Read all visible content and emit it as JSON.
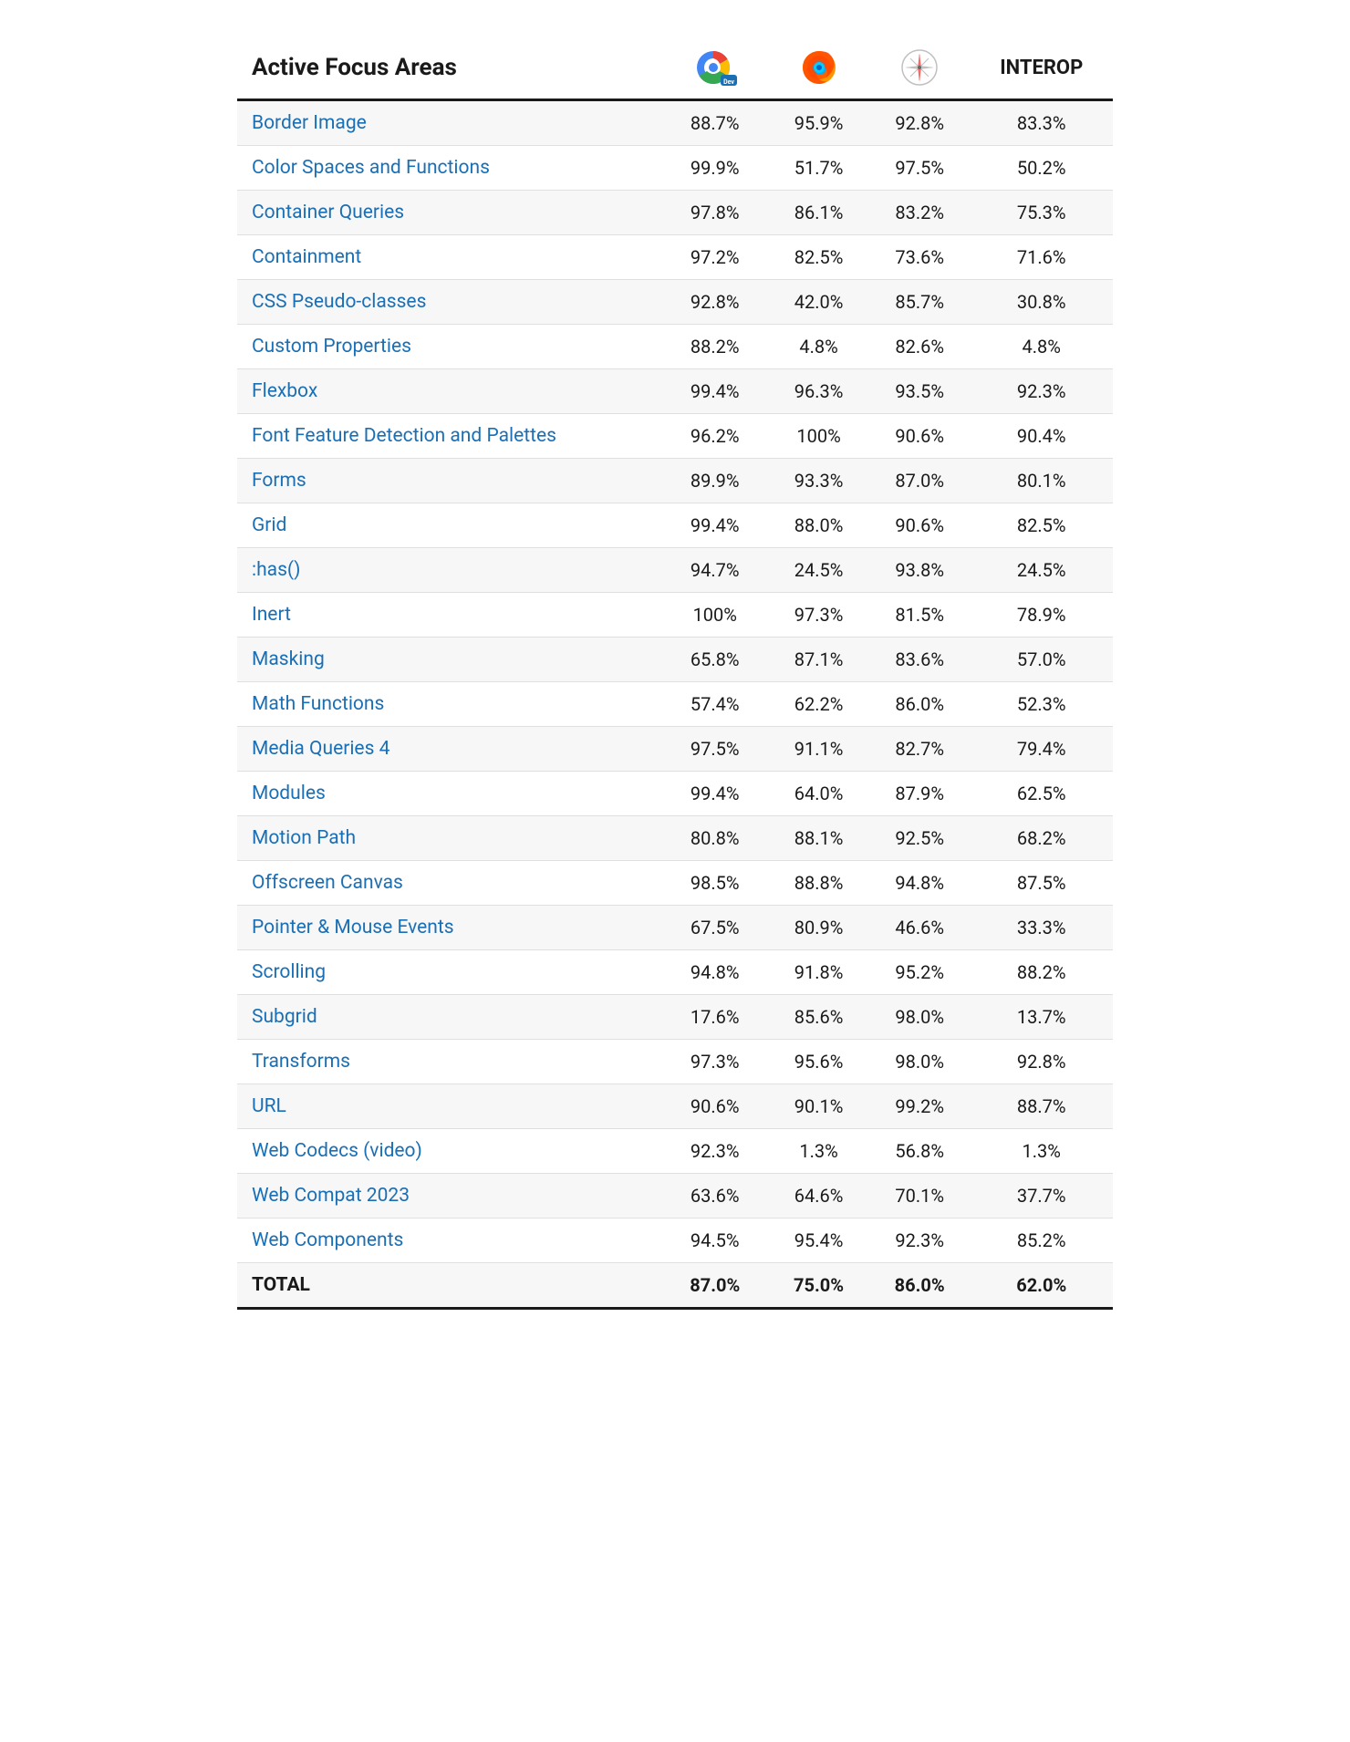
{
  "header": {
    "col1": "Active Focus Areas",
    "col4": "INTEROP"
  },
  "rows": [
    {
      "name": "Border Image",
      "col2": "88.7%",
      "col3": "95.9%",
      "col4": "92.8%",
      "col5": "83.3%"
    },
    {
      "name": "Color Spaces and Functions",
      "col2": "99.9%",
      "col3": "51.7%",
      "col4": "97.5%",
      "col5": "50.2%"
    },
    {
      "name": "Container Queries",
      "col2": "97.8%",
      "col3": "86.1%",
      "col4": "83.2%",
      "col5": "75.3%"
    },
    {
      "name": "Containment",
      "col2": "97.2%",
      "col3": "82.5%",
      "col4": "73.6%",
      "col5": "71.6%"
    },
    {
      "name": "CSS Pseudo-classes",
      "col2": "92.8%",
      "col3": "42.0%",
      "col4": "85.7%",
      "col5": "30.8%"
    },
    {
      "name": "Custom Properties",
      "col2": "88.2%",
      "col3": "4.8%",
      "col4": "82.6%",
      "col5": "4.8%"
    },
    {
      "name": "Flexbox",
      "col2": "99.4%",
      "col3": "96.3%",
      "col4": "93.5%",
      "col5": "92.3%"
    },
    {
      "name": "Font Feature Detection and Palettes",
      "col2": "96.2%",
      "col3": "100%",
      "col4": "90.6%",
      "col5": "90.4%"
    },
    {
      "name": "Forms",
      "col2": "89.9%",
      "col3": "93.3%",
      "col4": "87.0%",
      "col5": "80.1%"
    },
    {
      "name": "Grid",
      "col2": "99.4%",
      "col3": "88.0%",
      "col4": "90.6%",
      "col5": "82.5%"
    },
    {
      "name": ":has()",
      "col2": "94.7%",
      "col3": "24.5%",
      "col4": "93.8%",
      "col5": "24.5%"
    },
    {
      "name": "Inert",
      "col2": "100%",
      "col3": "97.3%",
      "col4": "81.5%",
      "col5": "78.9%"
    },
    {
      "name": "Masking",
      "col2": "65.8%",
      "col3": "87.1%",
      "col4": "83.6%",
      "col5": "57.0%"
    },
    {
      "name": "Math Functions",
      "col2": "57.4%",
      "col3": "62.2%",
      "col4": "86.0%",
      "col5": "52.3%"
    },
    {
      "name": "Media Queries 4",
      "col2": "97.5%",
      "col3": "91.1%",
      "col4": "82.7%",
      "col5": "79.4%"
    },
    {
      "name": "Modules",
      "col2": "99.4%",
      "col3": "64.0%",
      "col4": "87.9%",
      "col5": "62.5%"
    },
    {
      "name": "Motion Path",
      "col2": "80.8%",
      "col3": "88.1%",
      "col4": "92.5%",
      "col5": "68.2%"
    },
    {
      "name": "Offscreen Canvas",
      "col2": "98.5%",
      "col3": "88.8%",
      "col4": "94.8%",
      "col5": "87.5%"
    },
    {
      "name": "Pointer & Mouse Events",
      "col2": "67.5%",
      "col3": "80.9%",
      "col4": "46.6%",
      "col5": "33.3%"
    },
    {
      "name": "Scrolling",
      "col2": "94.8%",
      "col3": "91.8%",
      "col4": "95.2%",
      "col5": "88.2%"
    },
    {
      "name": "Subgrid",
      "col2": "17.6%",
      "col3": "85.6%",
      "col4": "98.0%",
      "col5": "13.7%"
    },
    {
      "name": "Transforms",
      "col2": "97.3%",
      "col3": "95.6%",
      "col4": "98.0%",
      "col5": "92.8%"
    },
    {
      "name": "URL",
      "col2": "90.6%",
      "col3": "90.1%",
      "col4": "99.2%",
      "col5": "88.7%"
    },
    {
      "name": "Web Codecs (video)",
      "col2": "92.3%",
      "col3": "1.3%",
      "col4": "56.8%",
      "col5": "1.3%"
    },
    {
      "name": "Web Compat 2023",
      "col2": "63.6%",
      "col3": "64.6%",
      "col4": "70.1%",
      "col5": "37.7%"
    },
    {
      "name": "Web Components",
      "col2": "94.5%",
      "col3": "95.4%",
      "col4": "92.3%",
      "col5": "85.2%"
    },
    {
      "name": "TOTAL",
      "col2": "87.0%",
      "col3": "75.0%",
      "col4": "86.0%",
      "col5": "62.0%",
      "isTotal": true
    }
  ]
}
